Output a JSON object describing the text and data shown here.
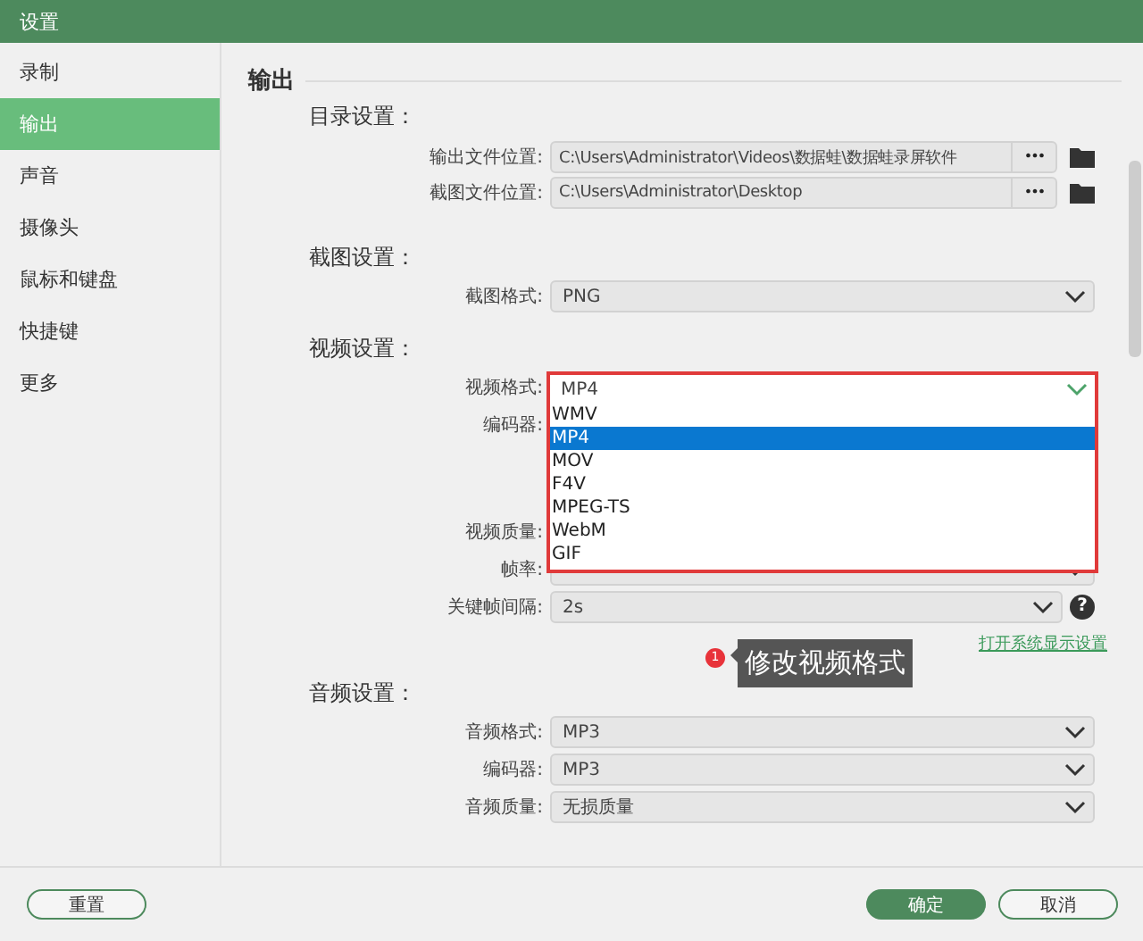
{
  "window": {
    "title": "设置"
  },
  "sidebar": {
    "items": [
      {
        "label": "录制",
        "selected": false
      },
      {
        "label": "输出",
        "selected": true
      },
      {
        "label": "声音",
        "selected": false
      },
      {
        "label": "摄像头",
        "selected": false
      },
      {
        "label": "鼠标和键盘",
        "selected": false
      },
      {
        "label": "快捷键",
        "selected": false
      },
      {
        "label": "更多",
        "selected": false
      }
    ]
  },
  "page": {
    "heading": "输出",
    "sections": [
      {
        "title": "目录设置：",
        "rows": [
          {
            "kind": "path",
            "label": "输出文件位置:",
            "value": "C:\\Users\\Administrator\\Videos\\数据蛙\\数据蛙录屏软件",
            "button": "•••"
          },
          {
            "kind": "path",
            "label": "截图文件位置:",
            "value": "C:\\Users\\Administrator\\Desktop",
            "button": "•••"
          }
        ]
      },
      {
        "title": "截图设置：",
        "rows": [
          {
            "kind": "select",
            "label": "截图格式:",
            "value": "PNG"
          }
        ]
      },
      {
        "title": "视频设置：",
        "rows": [
          {
            "kind": "select",
            "label": "视频格式:",
            "value": "MP4",
            "open": true,
            "options": [
              {
                "label": "WMV",
                "selected": false
              },
              {
                "label": "MP4",
                "selected": true
              },
              {
                "label": "MOV",
                "selected": false
              },
              {
                "label": "F4V",
                "selected": false
              },
              {
                "label": "MPEG-TS",
                "selected": false
              },
              {
                "label": "WebM",
                "selected": false
              },
              {
                "label": "GIF",
                "selected": false
              }
            ]
          },
          {
            "kind": "label",
            "label": "编码器:"
          },
          {
            "kind": "label",
            "label": "视频质量:"
          },
          {
            "kind": "select",
            "label": "帧率:"
          },
          {
            "kind": "select",
            "label": "关键帧间隔:",
            "value": "2s",
            "help": "?"
          },
          {
            "kind": "link",
            "label": "打开系统显示设置"
          }
        ]
      },
      {
        "title": "音频设置：",
        "rows": [
          {
            "kind": "select",
            "label": "音频格式:",
            "value": "MP3"
          },
          {
            "kind": "select",
            "label": "编码器:",
            "value": "MP3"
          },
          {
            "kind": "select",
            "label": "音频质量:",
            "value": "无损质量"
          }
        ]
      }
    ]
  },
  "callout": {
    "number": "1",
    "text": "修改视频格式"
  },
  "buttons": [
    {
      "label": "重置",
      "kind": "outline"
    },
    {
      "label": "确定",
      "kind": "primary"
    },
    {
      "label": "取消",
      "kind": "outline"
    }
  ]
}
